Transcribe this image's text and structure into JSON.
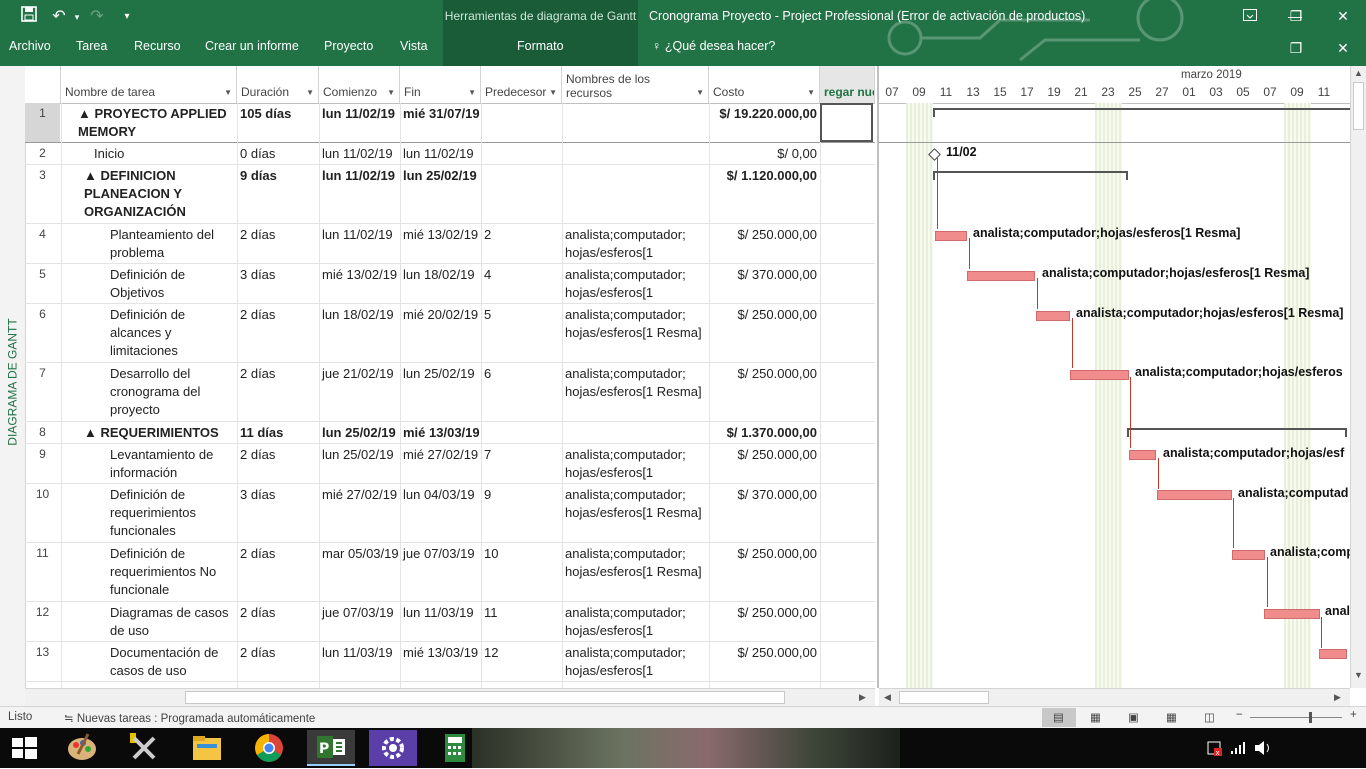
{
  "window": {
    "title": "Cronograma Proyecto - Project Professional (Error de activación de productos)",
    "context_tab_group": "Herramientas de diagrama de Gantt"
  },
  "ribbon": {
    "tabs": [
      "Archivo",
      "Tarea",
      "Recurso",
      "Crear un informe",
      "Proyecto",
      "Vista",
      "Formato"
    ],
    "tell_me": "¿Qué desea hacer?"
  },
  "view_label": "DIAGRAMA DE GANTT",
  "columns": {
    "name": "Nombre de tarea",
    "duration": "Duración",
    "start": "Comienzo",
    "finish": "Fin",
    "predecessors": "Predecesor",
    "resources": "Nombres de los recursos",
    "cost": "Costo",
    "add": "regar nue"
  },
  "tasks": [
    {
      "id": "1",
      "name": "▲ PROYECTO  APPLIED MEMORY",
      "duration": "105 días",
      "start": "lun 11/02/19",
      "finish": "mié 31/07/19",
      "pred": "",
      "res": "",
      "cost": "$/ 19.220.000,00"
    },
    {
      "id": "2",
      "name": "Inicio",
      "duration": "0 días",
      "start": "lun 11/02/19",
      "finish": "lun 11/02/19",
      "pred": "",
      "res": "",
      "cost": "$/ 0,00"
    },
    {
      "id": "3",
      "name": "▲ DEFINICION PLANEACION Y ORGANIZACIÓN",
      "duration": "9 días",
      "start": "lun 11/02/19",
      "finish": "lun 25/02/19",
      "pred": "",
      "res": "",
      "cost": "$/ 1.120.000,00"
    },
    {
      "id": "4",
      "name": "Planteamiento del problema",
      "duration": "2 días",
      "start": "lun 11/02/19",
      "finish": "mié 13/02/19",
      "pred": "2",
      "res": "analista;computador; hojas/esferos[1",
      "cost": "$/ 250.000,00"
    },
    {
      "id": "5",
      "name": "Definición de Objetivos",
      "duration": "3 días",
      "start": "mié 13/02/19",
      "finish": "lun 18/02/19",
      "pred": "4",
      "res": "analista;computador; hojas/esferos[1",
      "cost": "$/ 370.000,00"
    },
    {
      "id": "6",
      "name": "Definición de alcances y limitaciones",
      "duration": "2 días",
      "start": "lun 18/02/19",
      "finish": "mié 20/02/19",
      "pred": "5",
      "res": "analista;computador; hojas/esferos[1 Resma]",
      "cost": "$/ 250.000,00"
    },
    {
      "id": "7",
      "name": "Desarrollo del cronograma del proyecto",
      "duration": "2 días",
      "start": "jue 21/02/19",
      "finish": "lun 25/02/19",
      "pred": "6",
      "res": "analista;computador; hojas/esferos[1 Resma]",
      "cost": "$/ 250.000,00"
    },
    {
      "id": "8",
      "name": "▲ REQUERIMIENTOS",
      "duration": "11 días",
      "start": "lun 25/02/19",
      "finish": "mié 13/03/19",
      "pred": "",
      "res": "",
      "cost": "$/ 1.370.000,00"
    },
    {
      "id": "9",
      "name": "Levantamiento  de información",
      "duration": "2 días",
      "start": "lun 25/02/19",
      "finish": "mié 27/02/19",
      "pred": "7",
      "res": "analista;computador; hojas/esferos[1",
      "cost": "$/ 250.000,00"
    },
    {
      "id": "10",
      "name": "Definición de requerimientos funcionales",
      "duration": "3 días",
      "start": "mié 27/02/19",
      "finish": "lun 04/03/19",
      "pred": "9",
      "res": "analista;computador; hojas/esferos[1 Resma]",
      "cost": "$/ 370.000,00"
    },
    {
      "id": "11",
      "name": "Definición de requerimientos No funcionale",
      "duration": "2 días",
      "start": "mar 05/03/19",
      "finish": "jue 07/03/19",
      "pred": "10",
      "res": "analista;computador; hojas/esferos[1 Resma]",
      "cost": "$/ 250.000,00"
    },
    {
      "id": "12",
      "name": "Diagramas de casos de uso",
      "duration": "2 días",
      "start": "jue 07/03/19",
      "finish": "lun 11/03/19",
      "pred": "11",
      "res": "analista;computador; hojas/esferos[1",
      "cost": "$/ 250.000,00"
    },
    {
      "id": "13",
      "name": "Documentación de casos de uso",
      "duration": "2 días",
      "start": "lun 11/03/19",
      "finish": "mié 13/03/19",
      "pred": "12",
      "res": "analista;computador; hojas/esferos[1",
      "cost": "$/ 250.000,00"
    }
  ],
  "timescale": {
    "month": "marzo 2019",
    "days": [
      "07",
      "09",
      "11",
      "13",
      "15",
      "17",
      "19",
      "21",
      "23",
      "25",
      "27",
      "01",
      "03",
      "05",
      "07",
      "09",
      "11"
    ]
  },
  "gantt_labels": {
    "milestone": "11/02",
    "t4": "analista;computador;hojas/esferos[1 Resma]",
    "t5": "analista;computador;hojas/esferos[1 Resma]",
    "t6": "analista;computador;hojas/esferos[1 Resma]",
    "t7": "analista;computador;hojas/esferos",
    "t9": "analista;computador;hojas/esf",
    "t10": "analista;computad",
    "t11": "analista;comp",
    "t12": "anal"
  },
  "status": {
    "ready": "Listo",
    "new_tasks": "Nuevas tareas : Programada automáticamente"
  },
  "colors": {
    "accent": "#217346",
    "bar": "#f08c8c",
    "link": "#c0392b"
  }
}
